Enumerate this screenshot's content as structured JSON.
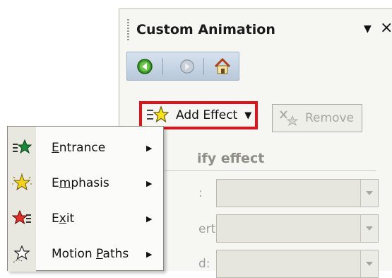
{
  "pane": {
    "title": "Custom Animation",
    "dropdown_glyph": "▼",
    "close_glyph": "×"
  },
  "navbar": {
    "back_icon": "back-arrow-icon",
    "forward_icon": "forward-arrow-icon",
    "home_icon": "home-icon"
  },
  "toolbar": {
    "add_effect_label": "Add Effect",
    "add_effect_caret": "▼",
    "remove_label": "Remove"
  },
  "modify": {
    "heading_visible": "ify effect",
    "fields": [
      {
        "label_visible": ":"
      },
      {
        "label_visible": "erty:"
      },
      {
        "label_visible": "d:"
      }
    ]
  },
  "menu": {
    "items": [
      {
        "pre": "",
        "u": "E",
        "post": "ntrance",
        "icon": "entrance-star-icon",
        "color": "#1a8a3a"
      },
      {
        "pre": "E",
        "u": "m",
        "post": "phasis",
        "icon": "emphasis-star-icon",
        "color": "#f2d21a"
      },
      {
        "pre": "E",
        "u": "x",
        "post": "it",
        "icon": "exit-star-icon",
        "color": "#e0322a"
      },
      {
        "pre": "Motion ",
        "u": "P",
        "post": "aths",
        "icon": "motion-paths-star-icon",
        "color": "#ffffff"
      }
    ],
    "submenu_glyph": "▶"
  },
  "colors": {
    "highlight_border": "#e0121a",
    "pane_background": "#f6f6f2",
    "nav_gradient_top": "#d6e2ef"
  }
}
